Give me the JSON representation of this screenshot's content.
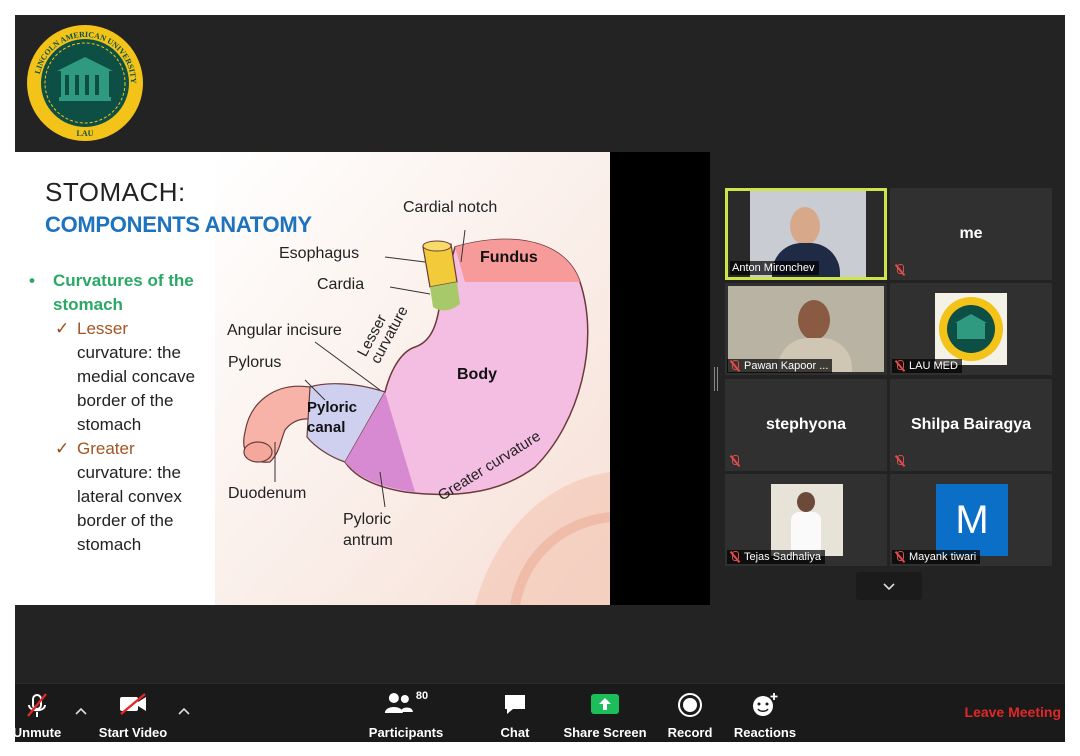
{
  "logo": {
    "text_top": "LINCOLN AMERICAN UNIVERSITY",
    "text_bottom": "LAU",
    "colors": {
      "ring": "#f3c31a",
      "inner": "#0d4f44",
      "building": "#2f9a7f"
    }
  },
  "slide": {
    "title": "STOMACH:",
    "subtitle": "COMPONENTS ANATOMY",
    "bullet": "Curvatures of the stomach",
    "subs": [
      {
        "head": "Lesser",
        "body": "curvature: the medial concave border of the stomach"
      },
      {
        "head": "Greater",
        "body": "curvature: the lateral convex border of the stomach"
      }
    ],
    "labels": {
      "cardial_notch": "Cardial notch",
      "esophagus": "Esophagus",
      "fundus": "Fundus",
      "cardia": "Cardia",
      "angular_incisure": "Angular incisure",
      "lesser_curvature": "Lesser curvature",
      "pylorus": "Pylorus",
      "body": "Body",
      "pyloric_canal": "Pyloric canal",
      "greater_curvature": "Greater curvature",
      "duodenum": "Duodenum",
      "pyloric_antrum": "Pyloric antrum"
    }
  },
  "gallery": {
    "tiles": [
      {
        "label": "Anton Mironchev",
        "active": true,
        "muted": false,
        "type": "video"
      },
      {
        "name": "me",
        "muted": true,
        "type": "name"
      },
      {
        "label": "Pawan Kapoor ...",
        "muted": true,
        "type": "video"
      },
      {
        "label": "LAU MED",
        "muted": true,
        "type": "logo"
      },
      {
        "name": "stephyona",
        "muted": true,
        "type": "name"
      },
      {
        "name": "Shilpa Bairagya",
        "muted": true,
        "type": "name"
      },
      {
        "label": "Tejas Sadhaliya",
        "muted": true,
        "type": "photo"
      },
      {
        "label": "Mayank tiwari",
        "muted": true,
        "type": "avatar",
        "initial": "M"
      }
    ],
    "more_icon": "chevron-down-icon"
  },
  "toolbar": {
    "unmute": "Unmute",
    "start_video": "Start Video",
    "participants": "Participants",
    "participants_count": "80",
    "chat": "Chat",
    "share_screen": "Share Screen",
    "record": "Record",
    "reactions": "Reactions",
    "leave": "Leave Meeting"
  },
  "colors": {
    "accent_green": "#2aa865",
    "active_border": "#cfe34a",
    "leave": "#e02828",
    "share": "#1ebd5c",
    "avatar_blue": "#0b6fc7"
  }
}
